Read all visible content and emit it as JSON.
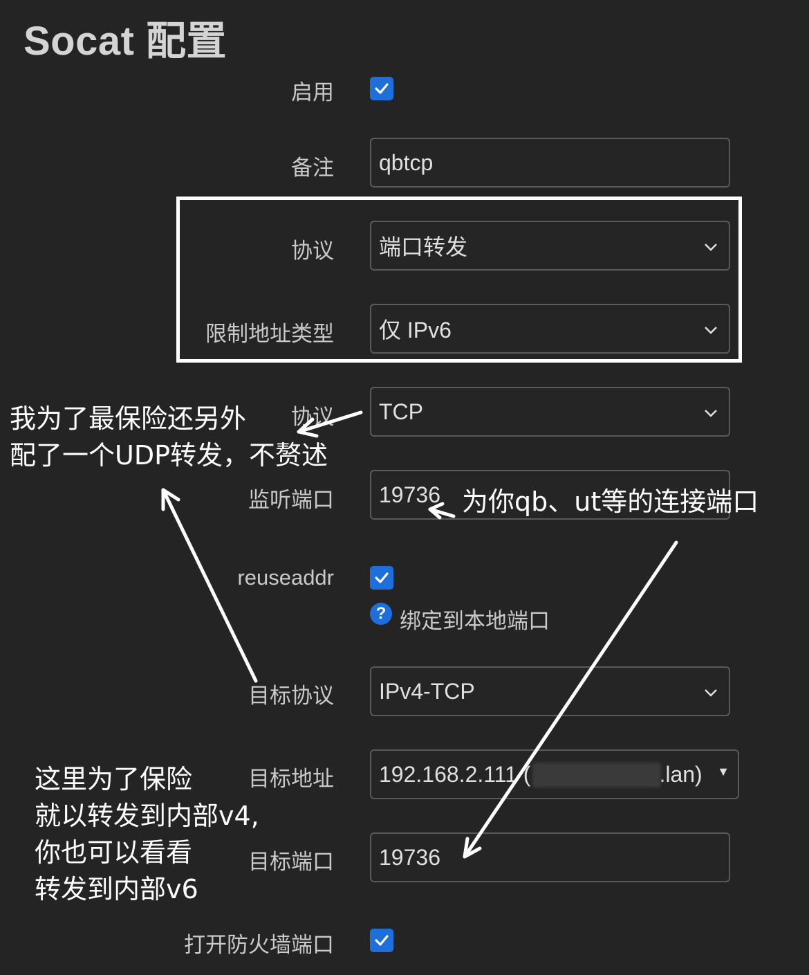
{
  "title": "Socat 配置",
  "form": {
    "enable_label": "启用",
    "remark_label": "备注",
    "remark_value": "qbtcp",
    "mode_label": "协议",
    "mode_value": "端口转发",
    "addr_type_label": "限制地址类型",
    "addr_type_value": "仅 IPv6",
    "protocol_label": "协议",
    "protocol_value": "TCP",
    "listen_port_label": "监听端口",
    "listen_port_value": "19736",
    "reuseaddr_label": "reuseaddr",
    "reuseaddr_hint": "绑定到本地端口",
    "target_proto_label": "目标协议",
    "target_proto_value": "IPv4-TCP",
    "target_addr_label": "目标地址",
    "target_addr_value_prefix": "192.168.2.111 (",
    "target_addr_value_suffix": ".lan)",
    "target_port_label": "目标端口",
    "target_port_value": "19736",
    "firewall_label": "打开防火墙端口"
  },
  "annotations": {
    "udp_line1": "我为了最保险还另外",
    "udp_line2": "配了一个UDP转发，不赘述",
    "port_note": "为你qb、ut等的连接端口",
    "v4_line1": "这里为了保险",
    "v4_line2": "就以转发到内部v4,",
    "v4_line3": "你也可以看看",
    "v4_line4": "转发到内部v6"
  },
  "colors": {
    "background": "#242424",
    "checkbox": "#1e6fd9",
    "annotation": "#ffffff"
  }
}
